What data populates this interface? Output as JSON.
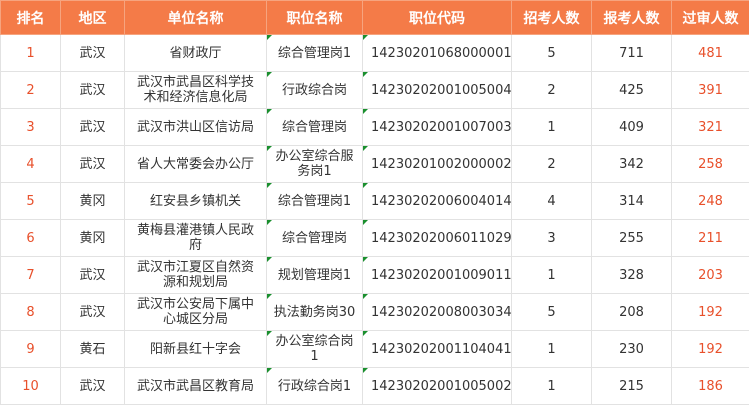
{
  "table": {
    "headers": [
      "排名",
      "地区",
      "单位名称",
      "职位名称",
      "职位代码",
      "招考人数",
      "报考人数",
      "过审人数"
    ],
    "rows": [
      {
        "rank": "1",
        "region": "武汉",
        "unit": "省财政厅",
        "position": "综合管理岗1",
        "code": "14230201068000001",
        "quota": "5",
        "applicants": "711",
        "passed": "481"
      },
      {
        "rank": "2",
        "region": "武汉",
        "unit": "武汉市武昌区科学技术和经济信息化局",
        "position": "行政综合岗",
        "code": "14230202001005004",
        "quota": "2",
        "applicants": "425",
        "passed": "391"
      },
      {
        "rank": "3",
        "region": "武汉",
        "unit": "武汉市洪山区信访局",
        "position": "综合管理岗",
        "code": "14230202001007003",
        "quota": "1",
        "applicants": "409",
        "passed": "321"
      },
      {
        "rank": "4",
        "region": "武汉",
        "unit": "省人大常委会办公厅",
        "position": "办公室综合服务岗1",
        "code": "14230201002000002",
        "quota": "2",
        "applicants": "342",
        "passed": "258"
      },
      {
        "rank": "5",
        "region": "黄冈",
        "unit": "红安县乡镇机关",
        "position": "综合管理岗1",
        "code": "14230202006004014",
        "quota": "4",
        "applicants": "314",
        "passed": "248"
      },
      {
        "rank": "6",
        "region": "黄冈",
        "unit": "黄梅县灌港镇人民政府",
        "position": "综合管理岗",
        "code": "14230202006011029",
        "quota": "3",
        "applicants": "255",
        "passed": "211"
      },
      {
        "rank": "7",
        "region": "武汉",
        "unit": "武汉市江夏区自然资源和规划局",
        "position": "规划管理岗1",
        "code": "14230202001009011",
        "quota": "1",
        "applicants": "328",
        "passed": "203"
      },
      {
        "rank": "8",
        "region": "武汉",
        "unit": "武汉市公安局下属中心城区分局",
        "position": "执法勤务岗30",
        "code": "14230202008003034",
        "quota": "5",
        "applicants": "208",
        "passed": "192"
      },
      {
        "rank": "9",
        "region": "黄石",
        "unit": "阳新县红十字会",
        "position": "办公室综合岗1",
        "code": "14230202001104041",
        "quota": "1",
        "applicants": "230",
        "passed": "192"
      },
      {
        "rank": "10",
        "region": "武汉",
        "unit": "武汉市武昌区教育局",
        "position": "行政综合岗1",
        "code": "14230202001005002",
        "quota": "1",
        "applicants": "215",
        "passed": "186"
      }
    ]
  },
  "colors": {
    "header_bg": "#f47b48",
    "accent_text": "#e8502b",
    "marker": "#1a8f2e"
  }
}
